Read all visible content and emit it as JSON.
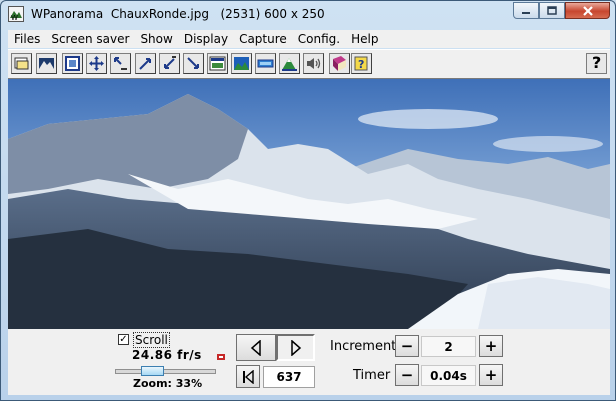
{
  "window": {
    "title": "WPanorama  ChauxRonde.jpg   (2531) 600 x 250"
  },
  "menu": [
    "Files",
    "Screen saver",
    "Show",
    "Display",
    "Capture",
    "Config.",
    "Help"
  ],
  "toolbar": {
    "icons": [
      "open-file-icon",
      "landscape-icon",
      "frame-icon",
      "move-icon",
      "shrink-icon",
      "zoom-arrow-icon",
      "fit-arrow-icon",
      "expand-arrow-icon",
      "image-window-icon",
      "panorama-icon",
      "strip-icon",
      "mountain-icon",
      "speaker-icon",
      "book-icon",
      "help-book-icon",
      "help-icon"
    ],
    "help_label": "?"
  },
  "panel": {
    "scroll_label": "Scroll",
    "scroll_checked": true,
    "speed": "24.86 fr/s",
    "zoom": "Zoom: 33%",
    "zoom_fraction": 0.33,
    "position": "637",
    "increment_label": "Increment",
    "increment_value": "2",
    "timer_label": "Timer",
    "timer_value": "0.04s",
    "minus": "−",
    "plus": "+"
  }
}
